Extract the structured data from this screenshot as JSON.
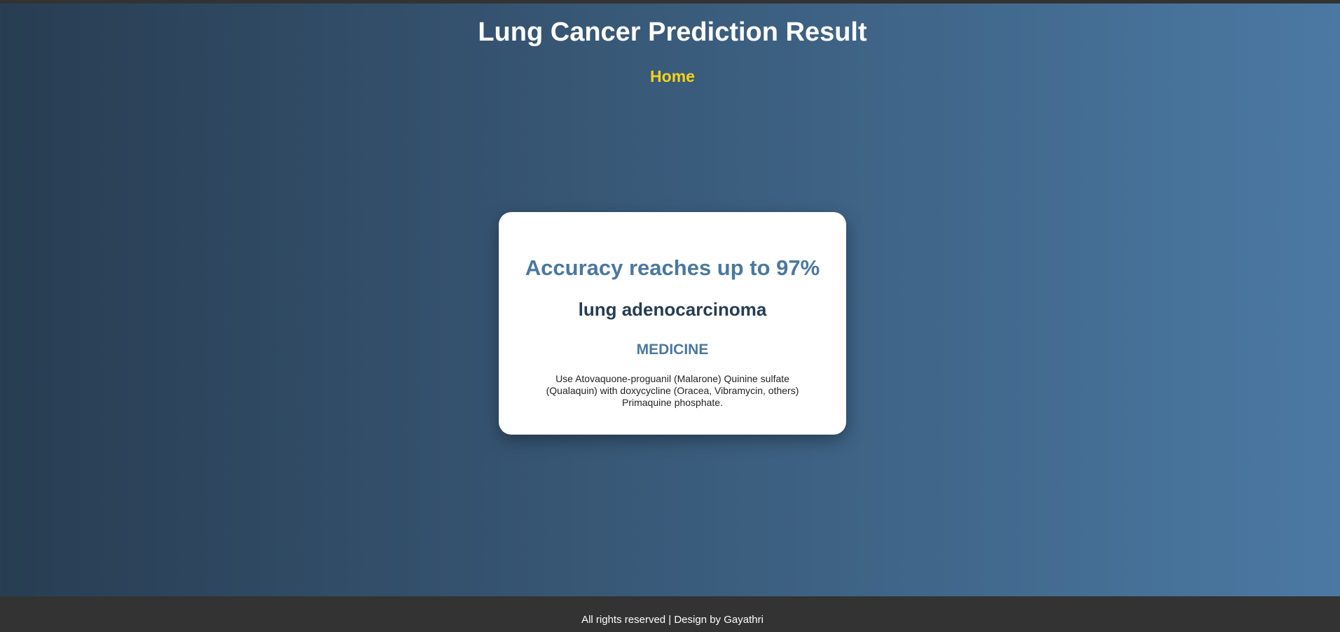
{
  "header": {
    "title": "Lung Cancer Prediction Result",
    "nav_home": "Home"
  },
  "result": {
    "accuracy_text": "Accuracy reaches up to 97%",
    "diagnosis": "lung adenocarcinoma",
    "medicine_heading": "MEDICINE",
    "medicine_text": "Use Atovaquone-proguanil (Malarone) Quinine sulfate (Qualaquin) with doxycycline (Oracea, Vibramycin, others) Primaquine phosphate."
  },
  "footer": {
    "text": "All rights reserved | Design by Gayathri"
  },
  "colors": {
    "gradient_start": "#283d52",
    "gradient_end": "#4b79a3",
    "nav_link": "#f5d316",
    "accent": "#4a78a0",
    "footer_bg": "#333333"
  }
}
